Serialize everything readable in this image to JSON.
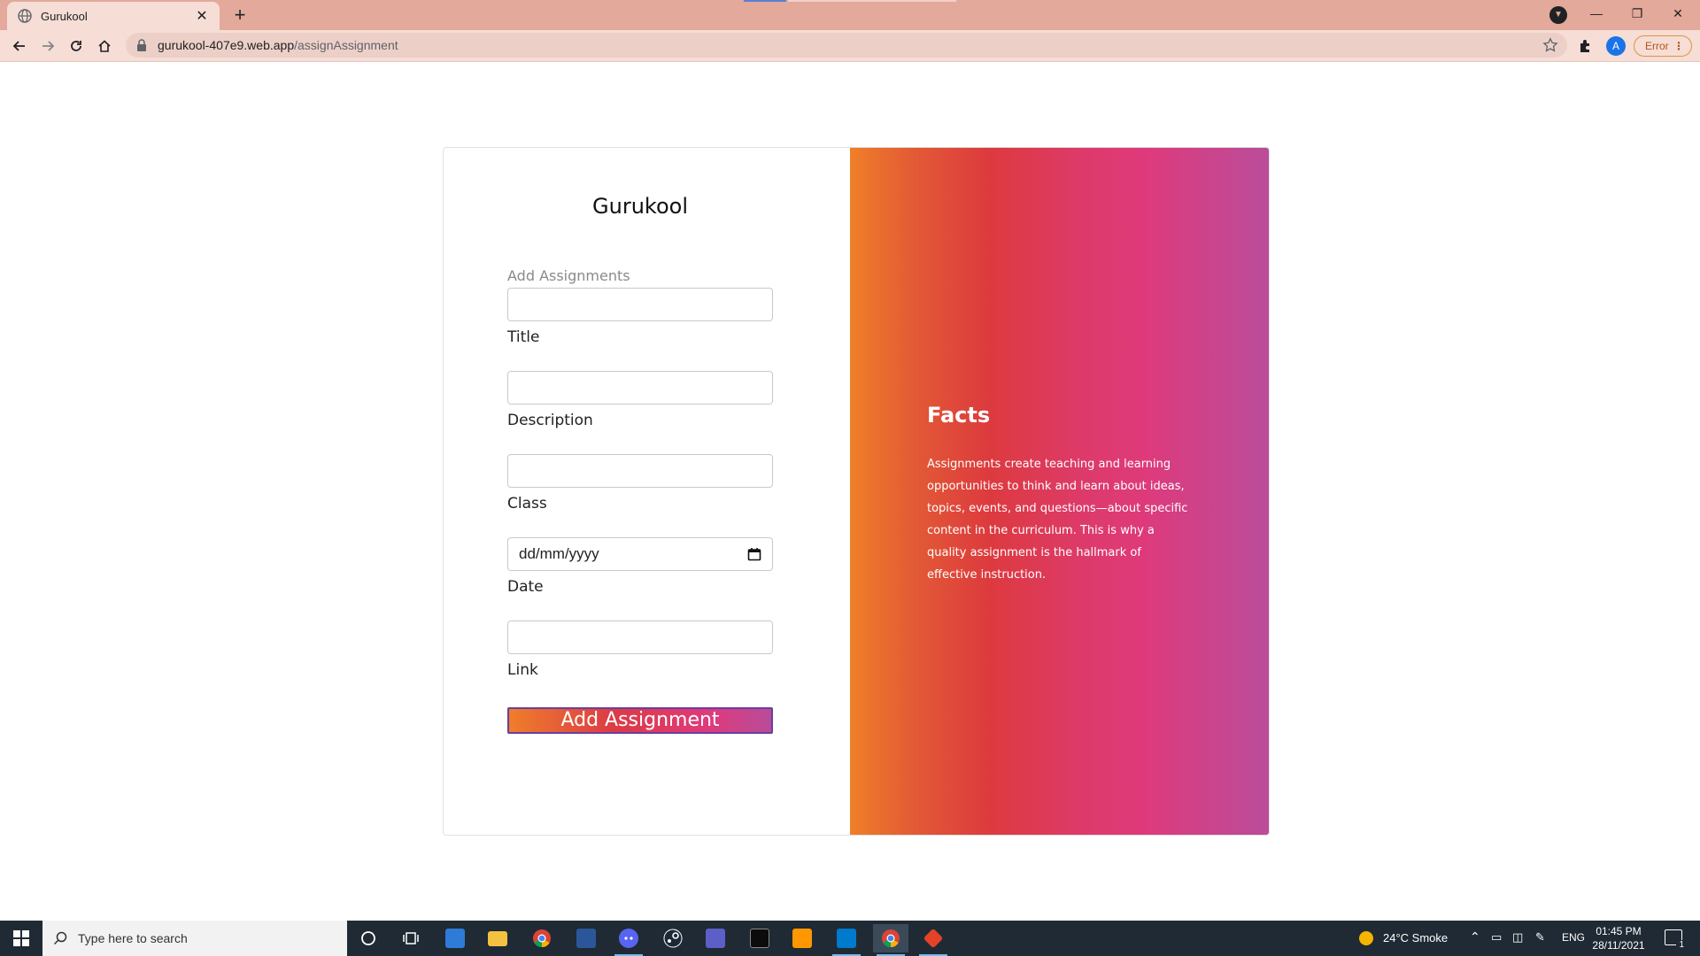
{
  "browser": {
    "tab_title": "Gurukool",
    "tab_close": "✕",
    "new_tab": "+",
    "url_host": "gurukool-407e9.web.app",
    "url_path": "/assignAssignment",
    "profile_initial": "A",
    "error_label": "Error",
    "error_menu": "⋮",
    "window_controls": {
      "minimize": "—",
      "restore": "❐",
      "close": "✕"
    }
  },
  "form": {
    "brand": "Gurukool",
    "section_label": "Add Assignments",
    "fields": [
      {
        "label": "Title",
        "value": ""
      },
      {
        "label": "Description",
        "value": ""
      },
      {
        "label": "Class",
        "value": ""
      },
      {
        "label": "Date",
        "value": "dd/mm/yyyy"
      },
      {
        "label": "Link",
        "value": ""
      }
    ],
    "submit_label": "Add Assignment"
  },
  "facts": {
    "title": "Facts",
    "body": "Assignments create teaching and learning opportunities to think and learn about ideas, topics, events, and questions—about specific content in the curriculum. This is why a quality assignment is the hallmark of effective instruction."
  },
  "taskbar": {
    "search_placeholder": "Type here to search",
    "weather": "24°C  Smoke",
    "language": "ENG",
    "time": "01:45 PM",
    "date": "28/11/2021",
    "notification_count": "1",
    "apps": [
      "cortana-icon",
      "task-view-icon",
      "store-icon",
      "file-explorer-icon",
      "chrome-icon",
      "word-icon",
      "discord-icon",
      "steam-icon",
      "teams-icon",
      "terminal-icon",
      "sublime-icon",
      "vscode-icon",
      "chrome-profile-icon",
      "git-icon"
    ]
  },
  "colors": {
    "accent_orange": "#ef7e2a",
    "accent_red": "#dc3b45",
    "accent_pink": "#df3a7a",
    "accent_purple": "#b94b9a",
    "chrome_tab_bar": "#e3a99a"
  }
}
